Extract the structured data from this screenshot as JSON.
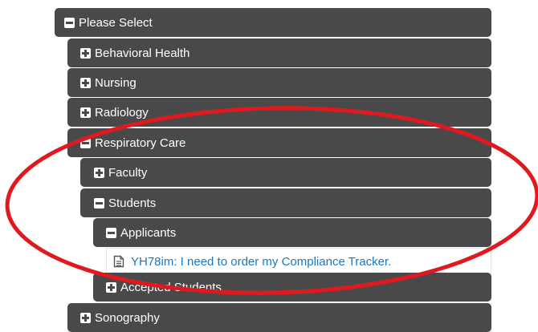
{
  "tree": {
    "root": {
      "label": "Please Select",
      "state": "expanded"
    },
    "items": [
      {
        "label": "Behavioral Health",
        "state": "collapsed"
      },
      {
        "label": "Nursing",
        "state": "collapsed"
      },
      {
        "label": "Radiology",
        "state": "collapsed"
      },
      {
        "label": "Respiratory Care",
        "state": "expanded"
      },
      {
        "label": "Faculty",
        "state": "collapsed"
      },
      {
        "label": "Students",
        "state": "expanded"
      },
      {
        "label": "Applicants",
        "state": "expanded"
      },
      {
        "label": "YH78im: I need to order my Compliance Tracker.",
        "type": "document-link"
      },
      {
        "label": "Accepted Students",
        "state": "collapsed"
      },
      {
        "label": "Sonography",
        "state": "collapsed"
      }
    ]
  },
  "colors": {
    "row_background": "#4a4949",
    "row_text": "#ffffff",
    "link": "#1a78c2",
    "annotation": "#e0191f"
  },
  "icons": {
    "expanded": "minus-square-icon",
    "collapsed": "plus-square-icon",
    "document": "document-icon"
  }
}
